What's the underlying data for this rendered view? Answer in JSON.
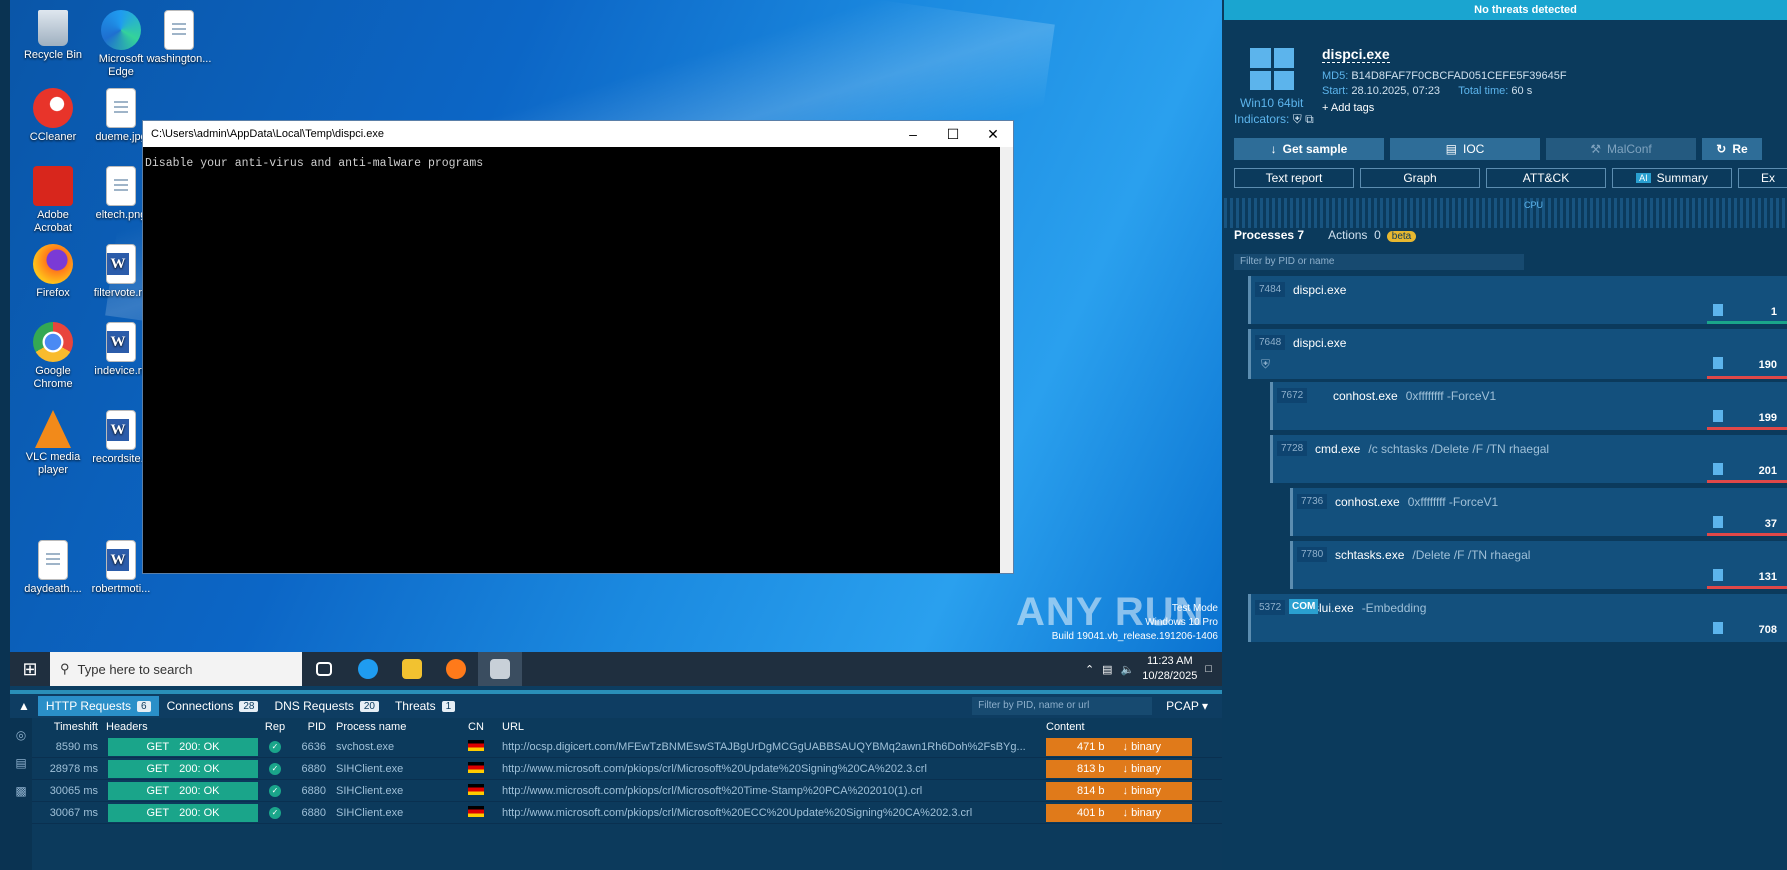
{
  "desktop": {
    "icons": [
      {
        "label": "Recycle Bin"
      },
      {
        "label": "Microsoft Edge"
      },
      {
        "label": "washington..."
      },
      {
        "label": "CCleaner"
      },
      {
        "label": "dueme.jpg"
      },
      {
        "label": "Adobe Acrobat"
      },
      {
        "label": "eltech.png"
      },
      {
        "label": "Firefox"
      },
      {
        "label": "filtervote.rtf"
      },
      {
        "label": "Google Chrome"
      },
      {
        "label": "indevice.rtf"
      },
      {
        "label": "VLC media player"
      },
      {
        "label": "recordsite..."
      },
      {
        "label": "daydeath...."
      },
      {
        "label": "robertmoti..."
      }
    ],
    "cmd_window": {
      "title": "C:\\Users\\admin\\AppData\\Local\\Temp\\dispci.exe",
      "text": "Disable your anti-virus and anti-malware programs"
    },
    "watermark": {
      "logo": "ANY RUN",
      "line1": "Test Mode",
      "line2": "Windows 10 Pro",
      "line3": "Build 19041.vb_release.191206-1406"
    }
  },
  "taskbar": {
    "search_placeholder": "Type here to search",
    "time": "11:23 AM",
    "date": "10/28/2025"
  },
  "bottom_panel": {
    "tabs": [
      {
        "label": "HTTP Requests",
        "count": "6"
      },
      {
        "label": "Connections",
        "count": "28"
      },
      {
        "label": "DNS Requests",
        "count": "20"
      },
      {
        "label": "Threats",
        "count": "1"
      }
    ],
    "filter_placeholder": "Filter by PID, name or url",
    "pcap_label": "PCAP",
    "columns": {
      "timeshift": "Timeshift",
      "headers": "Headers",
      "rep": "Rep",
      "pid": "PID",
      "process": "Process name",
      "cn": "CN",
      "url": "URL",
      "content": "Content"
    },
    "rows": [
      {
        "timeshift": "8590 ms",
        "method": "GET",
        "status": "200: OK",
        "pid": "6636",
        "process": "svchost.exe",
        "url": "http://ocsp.digicert.com/MFEwTzBNMEswSTAJBgUrDgMCGgUABBSAUQYBMq2awn1Rh6Doh%2FsBYg...",
        "size": "471 b",
        "type": "binary"
      },
      {
        "timeshift": "28978 ms",
        "method": "GET",
        "status": "200: OK",
        "pid": "6880",
        "process": "SIHClient.exe",
        "url": "http://www.microsoft.com/pkiops/crl/Microsoft%20Update%20Signing%20CA%202.3.crl",
        "size": "813 b",
        "type": "binary"
      },
      {
        "timeshift": "30065 ms",
        "method": "GET",
        "status": "200: OK",
        "pid": "6880",
        "process": "SIHClient.exe",
        "url": "http://www.microsoft.com/pkiops/crl/Microsoft%20Time-Stamp%20PCA%202010(1).crl",
        "size": "814 b",
        "type": "binary"
      },
      {
        "timeshift": "30067 ms",
        "method": "GET",
        "status": "200: OK",
        "pid": "6880",
        "process": "SIHClient.exe",
        "url": "http://www.microsoft.com/pkiops/crl/Microsoft%20ECC%20Update%20Signing%20CA%202.3.crl",
        "size": "401 b",
        "type": "binary"
      }
    ]
  },
  "analysis": {
    "banner": "No threats detected",
    "os_label": "Win10 64bit",
    "filename": "dispci.exe",
    "md5_label": "MD5:",
    "md5": "B14D8FAF7F0CBCFAD051CEFE5F39645F",
    "start_label": "Start:",
    "start": "28.10.2025, 07:23",
    "total_label": "Total time:",
    "total": "60 s",
    "add_tags": "+ Add tags",
    "indicators_label": "Indicators:",
    "buttons_row1": [
      "Get sample",
      "IOC",
      "MalConf",
      "Re"
    ],
    "buttons_row2": [
      "Text report",
      "Graph",
      "ATT&CK",
      "Summary",
      "Ex"
    ],
    "ai_badge": "AI",
    "cpu_label": "CPU",
    "processes_tab": "Processes 7",
    "actions_tab": "Actions",
    "actions_count": "0",
    "beta": "beta",
    "filter_placeholder": "Filter by PID or name",
    "processes": [
      {
        "pid": "7484",
        "name": "dispci.exe",
        "args": "",
        "count": "1"
      },
      {
        "pid": "7648",
        "name": "dispci.exe",
        "args": "",
        "count": "190"
      },
      {
        "pid": "7672",
        "name": "conhost.exe",
        "args": "0xffffffff -ForceV1",
        "count": "199"
      },
      {
        "pid": "7728",
        "name": "cmd.exe",
        "args": "/c schtasks /Delete /F /TN rhaegal",
        "count": "201"
      },
      {
        "pid": "7736",
        "name": "conhost.exe",
        "args": "0xffffffff -ForceV1",
        "count": "37"
      },
      {
        "pid": "7780",
        "name": "schtasks.exe",
        "args": "/Delete /F /TN rhaegal",
        "count": "131"
      },
      {
        "pid": "5372",
        "name": "slui.exe",
        "args": "-Embedding",
        "count": "708",
        "badge": "COM"
      }
    ]
  }
}
